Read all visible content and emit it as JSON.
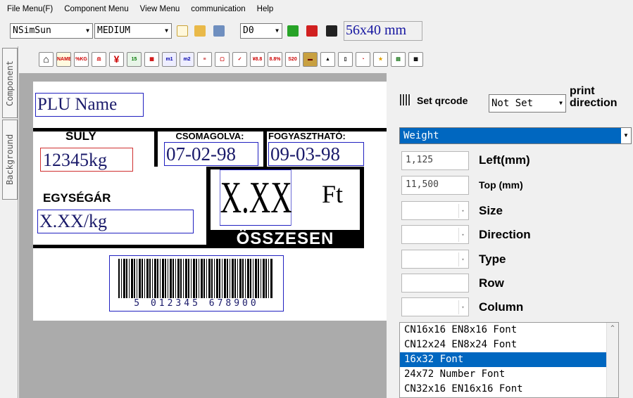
{
  "menu": [
    "File Menu(F)",
    "Component Menu",
    "View Menu",
    "communication",
    "Help"
  ],
  "toolbar": {
    "font_name": "NSimSun",
    "font_weight": "MEDIUM",
    "device": "D0",
    "label_size": "56x40 mm"
  },
  "tabs": {
    "component": "Component",
    "background": "Background"
  },
  "label": {
    "plu_name": "PLU Name",
    "weight_heading": "SÚLY",
    "weight_value": "12345kg",
    "packed_heading": "CSOMAGOLVA:",
    "packed_date": "07-02-98",
    "expiry_heading": "FOGYASZTHATÓ:",
    "expiry_date": "09-03-98",
    "unit_price_heading": "EGYSÉGÁR",
    "unit_price_value": "X.XX/kg",
    "total_value": "X.XX",
    "currency": "Ft",
    "total_heading": "ÖSSZESEN",
    "barcode_digits": "5 012345 678900"
  },
  "properties": {
    "qrcode_label": "Set qrcode",
    "qrcode_value": "Not Set",
    "print_direction_label": "print direction",
    "selected_component": "Weight",
    "left_value": "1,125",
    "left_label": "Left(mm)",
    "top_value": "11,500",
    "top_label": "Top (mm)",
    "size_label": "Size",
    "direction_label": "Direction",
    "type_label": "Type",
    "row_label": "Row",
    "column_label": "Column"
  },
  "font_list": [
    "CN16x16 EN8x16 Font",
    "CN12x24 EN8x24 Font",
    "16x32 Font",
    "24x72 Number Font",
    "CN32x16 EN16x16 Font"
  ],
  "font_list_selected": 2,
  "toolbar_icons": [
    "home-icon",
    "name-icon",
    "unit-kg-icon",
    "scale-icon",
    "yen-icon",
    "calendar-15-icon",
    "calendar-icon",
    "m1-icon",
    "m2-icon",
    "text-icon",
    "rect-icon",
    "check-icon",
    "price-icon",
    "unit-price-icon",
    "s20-code-icon",
    "box-icon",
    "bell-icon",
    "sequence-icon",
    "zoom-icon",
    "star-icon",
    "print-icon",
    "qrcode-icon"
  ]
}
